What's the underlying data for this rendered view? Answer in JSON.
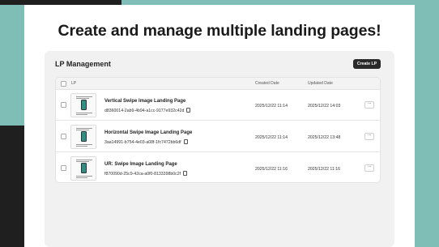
{
  "heading": "Create and manage multiple landing pages!",
  "panel": {
    "title": "LP Management",
    "create_button": "Create LP"
  },
  "table": {
    "columns": {
      "lp": "LP",
      "created": "Created Date",
      "updated": "Updated Date"
    },
    "rows": [
      {
        "name": "Vertical Swipe Image Landing Page",
        "id": "d8360014-2ab9-4b94-a1cc-9177e932c42d",
        "created": "2025/12/22 11:14",
        "updated": "2025/12/22 14:03"
      },
      {
        "name": "Horizontal Swipe Image Landing Page",
        "id": "3aa14991-b754-4e03-a08f-1fc7472bb6df",
        "created": "2025/12/22 11:14",
        "updated": "2025/12/22 13:48"
      },
      {
        "name": "UR: Swipe Image Landing Page",
        "id": "f870090d-25c9-42ca-a0f0-8133398b0c2f",
        "created": "2025/12/22 11:16",
        "updated": "2025/12/22 11:16"
      }
    ],
    "more_label": "···"
  },
  "colors": {
    "teal": "#7fbdb7",
    "dark": "#1f1f1f",
    "primary_button": "#2a2a2a"
  }
}
